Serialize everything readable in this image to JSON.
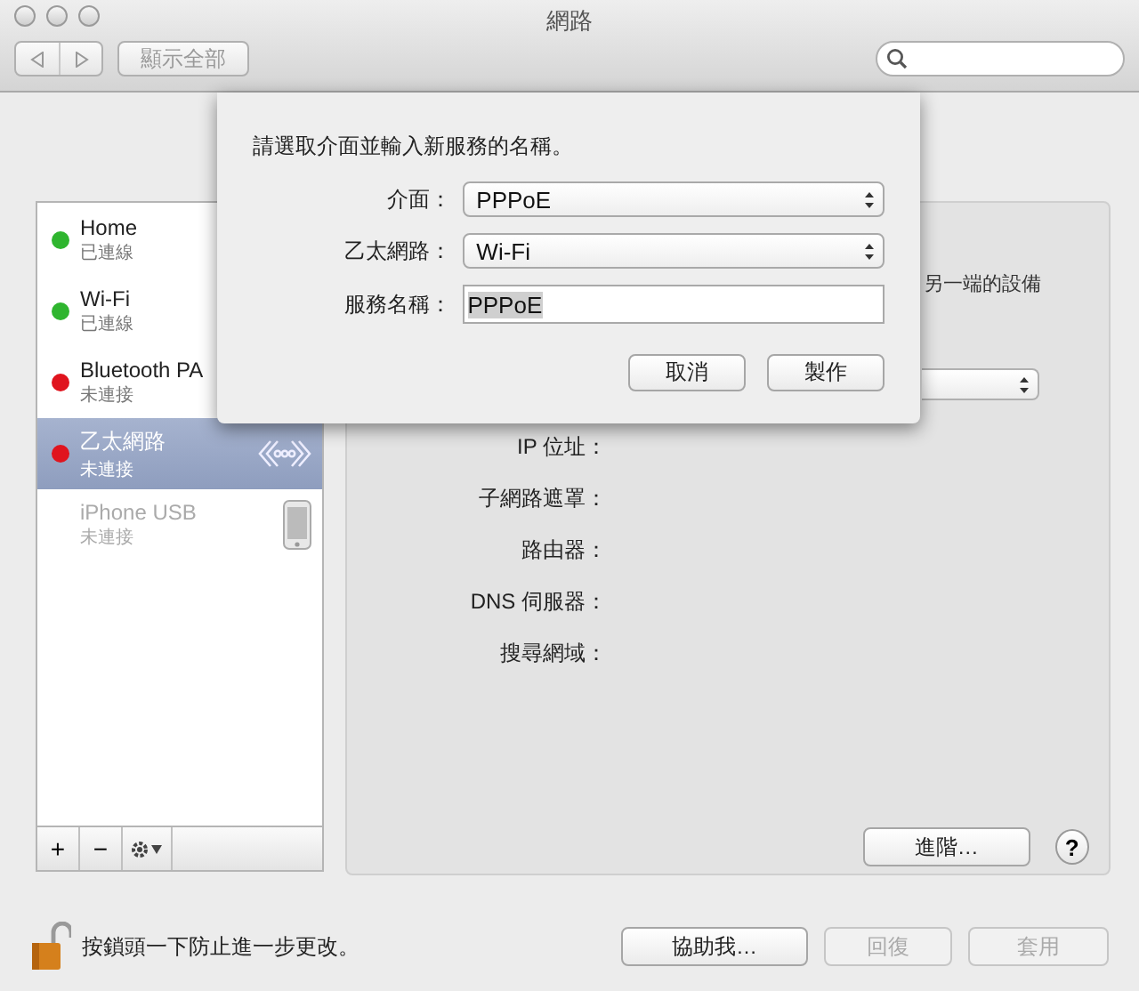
{
  "window": {
    "title": "網路"
  },
  "toolbar": {
    "show_all": "顯示全部"
  },
  "services": [
    {
      "name": "Home",
      "status": "已連線",
      "color": "#2fb52f",
      "selected": false,
      "disabled": false,
      "kind": "plain"
    },
    {
      "name": "Wi-Fi",
      "status": "已連線",
      "color": "#2fb52f",
      "selected": false,
      "disabled": false,
      "kind": "plain"
    },
    {
      "name": "Bluetooth PA",
      "status": "未連接",
      "color": "#e0141e",
      "selected": false,
      "disabled": false,
      "kind": "plain"
    },
    {
      "name": "乙太網路",
      "status": "未連接",
      "color": "#e0141e",
      "selected": true,
      "disabled": false,
      "kind": "ethernet"
    },
    {
      "name": "iPhone USB",
      "status": "未連接",
      "selected": false,
      "disabled": true,
      "kind": "phone"
    }
  ],
  "list_bar": {
    "add": "+",
    "remove": "−"
  },
  "detail": {
    "note": "另一端的設備",
    "fields": [
      "IP 位址：",
      "子網路遮罩：",
      "路由器：",
      "DNS 伺服器：",
      "搜尋網域："
    ],
    "advanced": "進階…",
    "help": "?"
  },
  "lock": {
    "text": "按鎖頭一下防止進一步更改。"
  },
  "buttons": [
    {
      "label": "協助我…",
      "disabled": false
    },
    {
      "label": "回復",
      "disabled": true
    },
    {
      "label": "套用",
      "disabled": true
    }
  ],
  "sheet": {
    "prompt": "請選取介面並輸入新服務的名稱。",
    "fields": [
      {
        "label": "介面：",
        "kind": "popup",
        "value": "PPPoE"
      },
      {
        "label": "乙太網路：",
        "kind": "popup",
        "value": "Wi-Fi"
      },
      {
        "label": "服務名稱：",
        "kind": "text",
        "value": "PPPoE"
      }
    ],
    "buttons": [
      "取消",
      "製作"
    ]
  }
}
